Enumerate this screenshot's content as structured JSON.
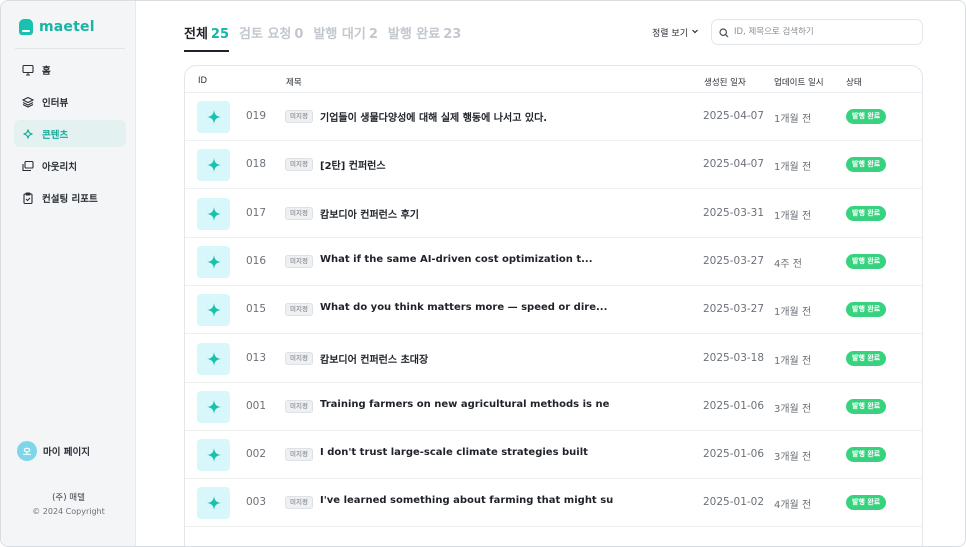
{
  "brand": {
    "name": "maetel",
    "accent": "#19b4a3"
  },
  "sidebar": {
    "items": [
      {
        "label": "홈",
        "icon": "monitor-icon"
      },
      {
        "label": "인터뷰",
        "icon": "layers-icon"
      },
      {
        "label": "콘텐츠",
        "icon": "sparkle-icon"
      },
      {
        "label": "아웃리치",
        "icon": "gallery-icon"
      },
      {
        "label": "컨설팅 리포트",
        "icon": "clipboard-icon"
      }
    ],
    "active_index": 2,
    "profile": {
      "avatar_text": "오",
      "label": "마이 페이지"
    },
    "company": "(주) 매텔",
    "copyright": "© 2024 Copyright"
  },
  "tabs": [
    {
      "label": "전체",
      "count": "25"
    },
    {
      "label": "검토 요청",
      "count": "0"
    },
    {
      "label": "발행 대기",
      "count": "2"
    },
    {
      "label": "발행 완료",
      "count": "23"
    }
  ],
  "toolbar": {
    "sort_label": "정렬 보기",
    "search_placeholder": "ID, 제목으로 검색하기"
  },
  "table": {
    "headers": {
      "id": "ID",
      "title": "제목",
      "created": "생성된 일자",
      "updated": "업데이트 일시",
      "status": "상태"
    },
    "rows": [
      {
        "id": "019",
        "tag": "미지정",
        "title": "기업들이 생물다양성에 대해 실제 행동에 나서고 있다.",
        "created": "2025-04-07",
        "updated": "1개월 전",
        "status": "발행 완료"
      },
      {
        "id": "018",
        "tag": "미지정",
        "title": "[2탄] 컨퍼런스",
        "created": "2025-04-07",
        "updated": "1개월 전",
        "status": "발행 완료"
      },
      {
        "id": "017",
        "tag": "미지정",
        "title": "캄보디아 컨퍼런스 후기",
        "created": "2025-03-31",
        "updated": "1개월 전",
        "status": "발행 완료"
      },
      {
        "id": "016",
        "tag": "미지정",
        "title": "What if the same AI-driven cost optimization t...",
        "created": "2025-03-27",
        "updated": "4주 전",
        "status": "발행 완료"
      },
      {
        "id": "015",
        "tag": "미지정",
        "title": "What do you think matters more — speed or dire...",
        "created": "2025-03-27",
        "updated": "1개월 전",
        "status": "발행 완료"
      },
      {
        "id": "013",
        "tag": "미지정",
        "title": "캄보디어 컨퍼런스 초대장",
        "created": "2025-03-18",
        "updated": "1개월 전",
        "status": "발행 완료"
      },
      {
        "id": "001",
        "tag": "미지정",
        "title": "Training farmers on new agricultural methods is ne",
        "created": "2025-01-06",
        "updated": "3개월 전",
        "status": "발행 완료"
      },
      {
        "id": "002",
        "tag": "미지정",
        "title": "I don't trust large-scale climate strategies built",
        "created": "2025-01-06",
        "updated": "3개월 전",
        "status": "발행 완료"
      },
      {
        "id": "003",
        "tag": "미지정",
        "title": "I've learned something about farming that might su",
        "created": "2025-01-02",
        "updated": "4개월 전",
        "status": "발행 완료"
      }
    ]
  },
  "colors": {
    "status_published": "#36d37f",
    "thumb_bg": "#d8f7fa",
    "thumb_icon": "#19c2b0"
  }
}
